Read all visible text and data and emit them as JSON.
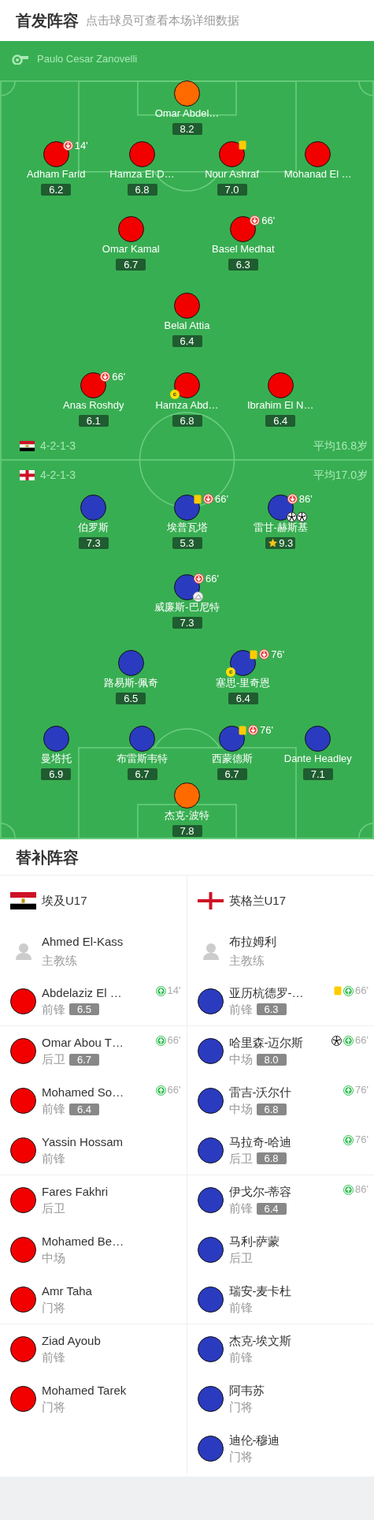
{
  "header": {
    "title": "首发阵容",
    "subtitle": "点击球员可查看本场详细数据"
  },
  "pitch": {
    "referee": "Paulo Cesar Zanovelli",
    "teams": [
      {
        "flag": {
          "kind": "egypt"
        },
        "formation": "4-2-1-3",
        "average_age": "平均16.8岁",
        "rows": [
          [
            {
              "name": "Omar Abdel…",
              "rating": "8.2",
              "color": "#ff6a00",
              "best": false
            }
          ],
          [
            {
              "name": "Adham Farid",
              "rating": "6.2",
              "color": "#f20000",
              "best": false,
              "events": [
                {
                  "kind": "sub_off",
                  "minute": "14'"
                }
              ]
            },
            {
              "name": "Hamza El D…",
              "rating": "6.8",
              "color": "#f20000",
              "best": false
            },
            {
              "name": "Nour Ashraf",
              "rating": "7.0",
              "color": "#f20000",
              "best": false,
              "events": [
                {
                  "kind": "yellow_card"
                }
              ]
            },
            {
              "name": "Mohanad El …",
              "color": "#f20000"
            }
          ],
          [
            {
              "name": "Omar Kamal",
              "rating": "6.7",
              "color": "#f20000",
              "best": false
            },
            {
              "name": "Basel Medhat",
              "rating": "6.3",
              "color": "#f20000",
              "best": false,
              "events": [
                {
                  "kind": "sub_off",
                  "minute": "66'"
                }
              ]
            }
          ],
          [
            {
              "name": "Belal Attia",
              "rating": "6.4",
              "color": "#f20000",
              "best": false
            }
          ],
          [
            {
              "name": "Anas Roshdy",
              "rating": "6.1",
              "color": "#f20000",
              "best": false,
              "events": [
                {
                  "kind": "sub_off",
                  "minute": "66'"
                }
              ]
            },
            {
              "name": "Hamza Abd…",
              "rating": "6.8",
              "color": "#f20000",
              "best": false,
              "captain": "c"
            },
            {
              "name": "Ibrahim El N…",
              "rating": "6.4",
              "color": "#f20000",
              "best": false
            }
          ]
        ]
      },
      {
        "flag": {
          "kind": "england"
        },
        "formation": "4-2-1-3",
        "average_age": "平均17.0岁",
        "rows": [
          [
            {
              "name": "伯罗斯",
              "rating": "7.3",
              "color": "#2a3bbf",
              "best": false
            },
            {
              "name": "埃普瓦塔",
              "rating": "5.3",
              "color": "#2a3bbf",
              "best": false,
              "events": [
                {
                  "kind": "yellow_card"
                },
                {
                  "kind": "sub_off",
                  "minute": "66'"
                }
              ]
            },
            {
              "name": "雷甘-赫斯基",
              "rating": "9.3",
              "color": "#2a3bbf",
              "best": true,
              "events": [
                {
                  "kind": "sub_off",
                  "minute": "86'"
                },
                {
                  "kind": "goal"
                },
                {
                  "kind": "goal"
                }
              ]
            }
          ],
          [
            {
              "name": "威廉斯-巴尼特",
              "rating": "7.3",
              "color": "#2a3bbf",
              "best": false,
              "events": [
                {
                  "kind": "sub_off",
                  "minute": "66'"
                },
                {
                  "kind": "assist"
                }
              ]
            }
          ],
          [
            {
              "name": "路易斯-佩奇",
              "rating": "6.5",
              "color": "#2a3bbf",
              "best": false
            },
            {
              "name": "塞思-里奇恩",
              "rating": "6.4",
              "color": "#2a3bbf",
              "best": false,
              "captain": "c",
              "events": [
                {
                  "kind": "yellow_card"
                },
                {
                  "kind": "sub_off",
                  "minute": "76'"
                }
              ]
            }
          ],
          [
            {
              "name": "曼塔托",
              "rating": "6.9",
              "color": "#2a3bbf",
              "best": false
            },
            {
              "name": "布雷斯韦特",
              "rating": "6.7",
              "color": "#2a3bbf",
              "best": false
            },
            {
              "name": "西蒙德斯",
              "rating": "6.7",
              "color": "#2a3bbf",
              "best": false,
              "events": [
                {
                  "kind": "yellow_card"
                },
                {
                  "kind": "sub_off",
                  "minute": "76'"
                }
              ]
            },
            {
              "name": "Dante Headley",
              "rating": "7.1",
              "color": "#2a3bbf",
              "best": false
            }
          ],
          [
            {
              "name": "杰克-波特",
              "rating": "7.8",
              "color": "#ff6a00",
              "best": false
            }
          ]
        ]
      }
    ]
  },
  "substitutes": {
    "title": "替补阵容",
    "teams": [
      {
        "flag": {
          "kind": "egypt"
        },
        "name": "埃及U17",
        "coach": {
          "name": "Ahmed El-Kass",
          "role": "主教练"
        },
        "players": [
          {
            "name": "Abdelaziz El …",
            "position": "前锋",
            "rating": "6.5",
            "color": "#f20000",
            "events": [
              {
                "kind": "sub_on",
                "minute": "14'"
              }
            ]
          },
          {
            "name": "Omar Abou T…",
            "position": "后卫",
            "rating": "6.7",
            "color": "#f20000",
            "events": [
              {
                "kind": "sub_on",
                "minute": "66'"
              }
            ]
          },
          {
            "name": "Mohamed So…",
            "position": "前锋",
            "rating": "6.4",
            "color": "#f20000",
            "events": [
              {
                "kind": "sub_on",
                "minute": "66'"
              }
            ]
          },
          {
            "name": "Yassin Hossam",
            "position": "前锋",
            "color": "#f20000"
          },
          {
            "name": "Fares Fakhri",
            "position": "后卫",
            "color": "#f20000"
          },
          {
            "name": "Mohamed Be…",
            "position": "中场",
            "color": "#f20000"
          },
          {
            "name": "Amr Taha",
            "position": "门将",
            "color": "#f20000"
          },
          {
            "name": "Ziad Ayoub",
            "position": "前锋",
            "color": "#f20000"
          },
          {
            "name": "Mohamed Tarek",
            "position": "门将",
            "color": "#f20000"
          }
        ]
      },
      {
        "flag": {
          "kind": "england"
        },
        "name": "英格兰U17",
        "coach": {
          "name": "布拉姆利",
          "role": "主教练"
        },
        "players": [
          {
            "name": "亚历杭德罗-…",
            "position": "前锋",
            "rating": "6.3",
            "color": "#2a3bbf",
            "events": [
              {
                "kind": "yellow_card"
              },
              {
                "kind": "sub_on",
                "minute": "66'"
              }
            ]
          },
          {
            "name": "哈里森-迈尔斯",
            "position": "中场",
            "rating": "8.0",
            "color": "#2a3bbf",
            "events": [
              {
                "kind": "goal"
              },
              {
                "kind": "sub_on",
                "minute": "66'"
              }
            ]
          },
          {
            "name": "雷吉-沃尔什",
            "position": "中场",
            "rating": "6.8",
            "color": "#2a3bbf",
            "events": [
              {
                "kind": "sub_on",
                "minute": "76'"
              }
            ]
          },
          {
            "name": "马拉奇-哈迪",
            "position": "后卫",
            "rating": "6.8",
            "color": "#2a3bbf",
            "events": [
              {
                "kind": "sub_on",
                "minute": "76'"
              }
            ]
          },
          {
            "name": "伊戈尔-蒂容",
            "position": "前锋",
            "rating": "6.4",
            "color": "#2a3bbf",
            "events": [
              {
                "kind": "sub_on",
                "minute": "86'"
              }
            ]
          },
          {
            "name": "马利-萨蒙",
            "position": "后卫",
            "color": "#2a3bbf"
          },
          {
            "name": "瑞安-麦卡杜",
            "position": "前锋",
            "color": "#2a3bbf"
          },
          {
            "name": "杰克-埃文斯",
            "position": "前锋",
            "color": "#2a3bbf"
          },
          {
            "name": "阿韦苏",
            "position": "门将",
            "color": "#2a3bbf"
          },
          {
            "name": "迪伦-穆迪",
            "position": "门将",
            "color": "#2a3bbf"
          }
        ]
      }
    ]
  }
}
